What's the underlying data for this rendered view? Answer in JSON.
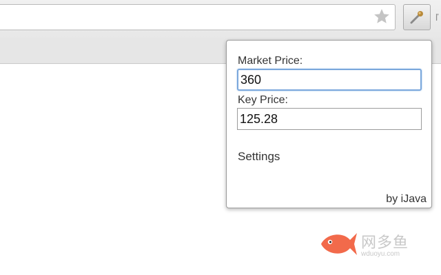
{
  "browser": {
    "bookmark_star_icon": "star-icon",
    "extension_icon": "wrench-icon"
  },
  "popup": {
    "market_price_label": "Market Price:",
    "market_price_value": "360",
    "key_price_label": "Key Price:",
    "key_price_value": "125.28",
    "settings_link": "Settings",
    "credit": "by iJava"
  },
  "watermark": {
    "text": "网多鱼",
    "url": "wduoyu.com",
    "color": "#f26a4b"
  }
}
